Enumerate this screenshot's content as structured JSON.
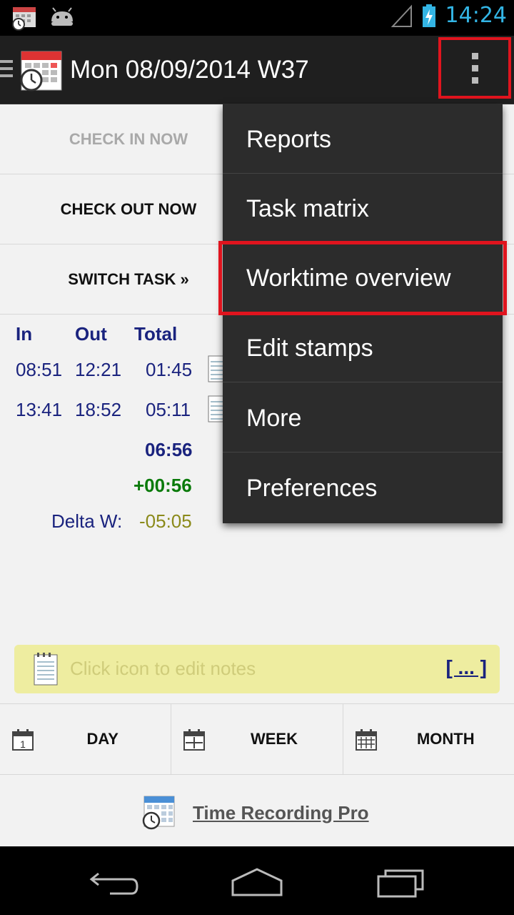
{
  "status_bar": {
    "time": "14:24"
  },
  "action_bar": {
    "title": "Mon 08/09/2014 W37"
  },
  "actions": {
    "check_in": "CHECK IN NOW",
    "check_out": "CHECK OUT NOW",
    "switch_task": "SWITCH TASK »"
  },
  "times_table": {
    "headers": {
      "in": "In",
      "out": "Out",
      "total": "Total"
    },
    "rows": [
      {
        "in": "08:51",
        "out": "12:21",
        "total": "01:45"
      },
      {
        "in": "13:41",
        "out": "18:52",
        "total": "05:11"
      }
    ],
    "sum_total": "06:56",
    "overtime": "+00:56",
    "delta_label": "Delta W:",
    "delta_value": "-05:05"
  },
  "notes": {
    "placeholder": "Click icon to edit notes",
    "more": "[ ... ]"
  },
  "tabs": [
    {
      "label": "DAY",
      "icon": "calendar-day-icon"
    },
    {
      "label": "WEEK",
      "icon": "calendar-week-icon"
    },
    {
      "label": "MONTH",
      "icon": "calendar-month-icon"
    }
  ],
  "promo": {
    "link": "Time Recording Pro"
  },
  "overflow_menu": {
    "items": [
      {
        "label": "Reports"
      },
      {
        "label": "Task matrix"
      },
      {
        "label": "Worktime overview"
      },
      {
        "label": "Edit stamps"
      },
      {
        "label": "More"
      },
      {
        "label": "Preferences"
      }
    ]
  },
  "colors": {
    "accent_blue": "#33b5e5",
    "highlight_red": "#e0141e",
    "text_navy": "#1a237e",
    "overtime_green": "#0a7a0a",
    "delta_olive": "#8b8a1a"
  }
}
